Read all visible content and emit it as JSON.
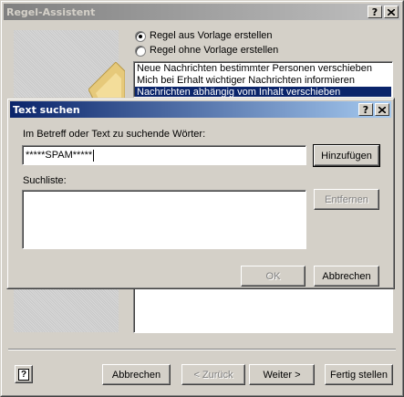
{
  "wizard": {
    "title": "Regel-Assistent",
    "help_btn": "?",
    "close_btn": "x",
    "radio_template": "Regel aus Vorlage erstellen",
    "radio_empty": "Regel ohne Vorlage erstellen",
    "templates": [
      "Neue Nachrichten bestimmter Personen verschieben",
      "Mich bei Erhalt wichtiger Nachrichten informieren",
      "Nachrichten abhängig vom Inhalt verschieben"
    ],
    "help_icon_label": "?",
    "cancel": "Abbrechen",
    "back": "< Zurück",
    "next": "Weiter >",
    "finish": "Fertig stellen"
  },
  "dialog": {
    "title": "Text suchen",
    "help_btn": "?",
    "close_btn": "x",
    "prompt": "Im Betreff oder Text zu suchende Wörter:",
    "input_value": "*****SPAM*****",
    "add": "Hinzufügen",
    "list_label": "Suchliste:",
    "remove": "Entfernen",
    "ok": "OK",
    "cancel": "Abbrechen"
  }
}
